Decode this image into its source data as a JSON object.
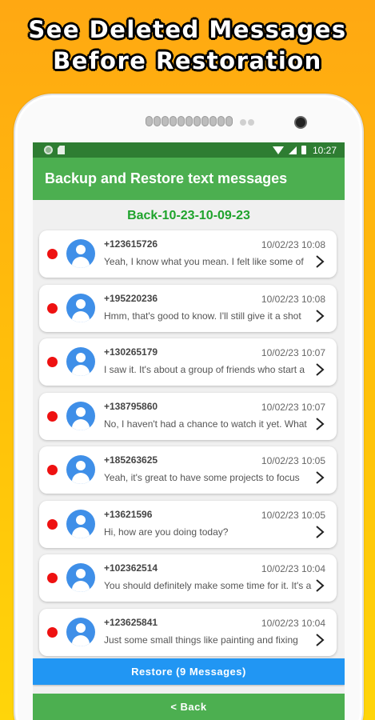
{
  "promo": {
    "line1": "See Deleted Messages",
    "line2": "Before Restoration"
  },
  "statusbar": {
    "time": "10:27",
    "icons": [
      "app-notification-icon",
      "sd-card-icon",
      "wifi-icon",
      "signal-icon",
      "battery-icon"
    ]
  },
  "appbar": {
    "title": "Backup and Restore text messages"
  },
  "backup": {
    "name": "Back-10-23-10-09-23"
  },
  "messages": [
    {
      "sender": "+123615726",
      "time": "10/02/23 10:08",
      "preview": "Yeah, I know what you mean. I felt like some of"
    },
    {
      "sender": "+195220236",
      "time": "10/02/23 10:08",
      "preview": "Hmm, that's good to know. I'll still give it a shot"
    },
    {
      "sender": "+130265179",
      "time": "10/02/23 10:07",
      "preview": "I saw it. It's about a group of friends who start a"
    },
    {
      "sender": "+138795860",
      "time": "10/02/23 10:07",
      "preview": "No, I haven't had a chance to watch it yet. What"
    },
    {
      "sender": "+185263625",
      "time": "10/02/23 10:05",
      "preview": "Yeah, it's great to have some projects to focus"
    },
    {
      "sender": "+13621596",
      "time": "10/02/23 10:05",
      "preview": "Hi, how are you doing today?"
    },
    {
      "sender": "+102362514",
      "time": "10/02/23 10:04",
      "preview": "You should definitely make some time for it. It's a"
    },
    {
      "sender": "+123625841",
      "time": "10/02/23 10:04",
      "preview": "Just some small things like painting and fixing"
    }
  ],
  "buttons": {
    "restore": "Restore (9 Messages)",
    "back": "< Back"
  },
  "colors": {
    "statusbar": "#2e7d32",
    "appbar": "#4caf50",
    "restore": "#2196f3",
    "unread": "#ee1111",
    "avatar": "#3f8fe8",
    "backup_title": "#1fa32c"
  }
}
